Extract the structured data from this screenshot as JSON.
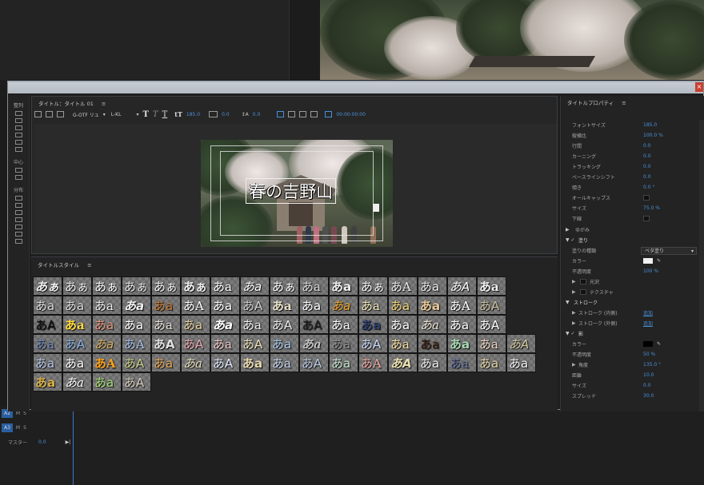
{
  "timeline": {
    "tracks": [
      {
        "id": "A2",
        "label": "A2",
        "m": "M",
        "s": "S"
      },
      {
        "id": "A3",
        "label": "A3",
        "m": "M",
        "s": "S"
      }
    ],
    "master_label": "マスター",
    "master_value": "0.0"
  },
  "tools": {
    "align_label": "整列",
    "center_label": "中心",
    "distribute_label": "分布"
  },
  "editor": {
    "title": "タイトル：タイトル 01",
    "menu_icon": "≡",
    "font_family": "G-OTF リュ",
    "font_style": "L-KL",
    "font_size": "185.0",
    "kerning": "0.0",
    "leading": "0.0",
    "timecode": "00:00:00:00",
    "title_text": "春の吉野山"
  },
  "styles": {
    "header": "タイトルスタイル",
    "menu_icon": "≡",
    "rows": [
      [
        "あぁ",
        "あぁ",
        "あぁ",
        "あぁ",
        "あぁ",
        "あぁ",
        "あa",
        "あa",
        "あぁ",
        "あa",
        "あa",
        "あぁ",
        "あA",
        "あa",
        "あA",
        "あa",
        ""
      ],
      [
        "あa",
        "あa",
        "あa",
        "あa",
        "あa",
        "あA",
        "あa",
        "あA",
        "あa",
        "あa",
        "あa",
        "あa",
        "あa",
        "あa",
        "あA",
        "あA",
        ""
      ],
      [
        "あA",
        "あa",
        "あa",
        "あa",
        "あa",
        "あa",
        "あa",
        "あa",
        "あA",
        "あA",
        "あa",
        "あa",
        "あa",
        "あa",
        "あa",
        "あA",
        ""
      ],
      [
        "あa",
        "あA",
        "あa",
        "あA",
        "あA",
        "あA",
        "あa",
        "あA",
        "あa",
        "あa",
        "あa",
        "あA",
        "あa",
        "あa",
        "あa",
        "あa",
        "あA"
      ],
      [
        "あa",
        "あa",
        "あA",
        "あA",
        "あa",
        "あa",
        "あA",
        "あa",
        "あa",
        "あA",
        "あa",
        "あA",
        "あA",
        "あa",
        "あa",
        "あa",
        "あa"
      ],
      [
        "あa",
        "あa",
        "あa",
        "あA"
      ]
    ],
    "colors": [
      [
        "#eeeeee",
        "#f0f0f0",
        "#ffffff",
        "#e8e8e8",
        "#f4f4f4",
        "#eeeeee",
        "#ffffff",
        "#ffffff",
        "#ffffff",
        "#dddddd",
        "#f0f0f0",
        "#f8f8f8",
        "#eeeeee",
        "#e8e8e8",
        "#ffffff",
        "#f0f0f0",
        ""
      ],
      [
        "#dddddd",
        "#dddddd",
        "#eeeeee",
        "#f0f0f0",
        "#c87830",
        "#ffffff",
        "#ffffff",
        "#d0d0d0",
        "#e8e0c8",
        "#ffffff",
        "#f0a830",
        "#f2e8b8",
        "#f4d878",
        "#e8c898",
        "#ffffff",
        "#c8c0a0",
        ""
      ],
      [
        "#111111",
        "#ffdc40",
        "#e89880",
        "#ffffff",
        "#e8e0d8",
        "#e8d0a0",
        "#ffffff",
        "#f0f0f0",
        "#e8e8e8",
        "#222222",
        "#ffffff",
        "#304068",
        "#ffffff",
        "#f0e8d8",
        "#ffffff",
        "#ffffff",
        ""
      ],
      [
        "#7088b8",
        "#88b0e0",
        "#d8b068",
        "#a8c0e8",
        "#e0e0e0",
        "#e8a8b0",
        "#f0c8c8",
        "#e8e0b8",
        "#a8c8e8",
        "#c0c0c0",
        "#909090",
        "#c8d8f8",
        "#f8e0a0",
        "#3a2010",
        "#a8d8b0",
        "#f0d8c8",
        "#d0c8a0"
      ],
      [
        "#b8c8e8",
        "#ffffff",
        "#f8a020",
        "#c8d088",
        "#e8a858",
        "#e8e0c0",
        "#e0e8ff",
        "#e8d8b0",
        "#c8d8f0",
        "#b8c8e0",
        "#c8e8d0",
        "#f0a8a0",
        "#e8e0b0",
        "#f0f0f0",
        "#6070a0",
        "#e8d8a8",
        "#f4f4f4"
      ],
      [
        "#d8b048",
        "#ffffff",
        "#a8e078",
        "#d8d0c0"
      ]
    ]
  },
  "props": {
    "header": "タイトルプロパティ",
    "menu_icon": "≡",
    "rows": [
      {
        "label": "フォントサイズ",
        "value": "185.0"
      },
      {
        "label": "縦横比",
        "value": "100.0 %"
      },
      {
        "label": "行間",
        "value": "0.0"
      },
      {
        "label": "カーニング",
        "value": "0.0"
      },
      {
        "label": "トラッキング",
        "value": "0.0"
      },
      {
        "label": "ベースラインシフト",
        "value": "0.0"
      },
      {
        "label": "傾き",
        "value": "0.0 °"
      },
      {
        "label": "オールキャップス",
        "value": ""
      },
      {
        "label": "サイズ",
        "value": "75.0 %"
      },
      {
        "label": "下線",
        "value": ""
      }
    ],
    "distort_label": "ゆがみ",
    "fill_label": "塗り",
    "fill_type_label": "塗りの種類",
    "fill_type_value": "ベタ塗り",
    "color_label": "カラー",
    "opacity_label": "不透明度",
    "opacity_value": "100 %",
    "sheen_label": "光沢",
    "texture_label": "テクスチャ",
    "stroke_label": "ストローク",
    "inner_stroke_label": "ストローク (内側)",
    "inner_stroke_value": "追加",
    "outer_stroke_label": "ストローク (外側)",
    "outer_stroke_value": "追加",
    "shadow_label": "影",
    "shadow_color_label": "カラー",
    "shadow_opacity_label": "不透明度",
    "shadow_opacity_value": "50 %",
    "angle_label": "角度",
    "angle_value": "135.0 °",
    "distance_label": "距離",
    "distance_value": "10.0",
    "size_label": "サイズ",
    "size_value": "0.0",
    "spread_label": "スプレッド",
    "spread_value": "30.0",
    "fill_color": "#f0f0f0",
    "shadow_color": "#000000",
    "accent": "#4a90d8"
  }
}
